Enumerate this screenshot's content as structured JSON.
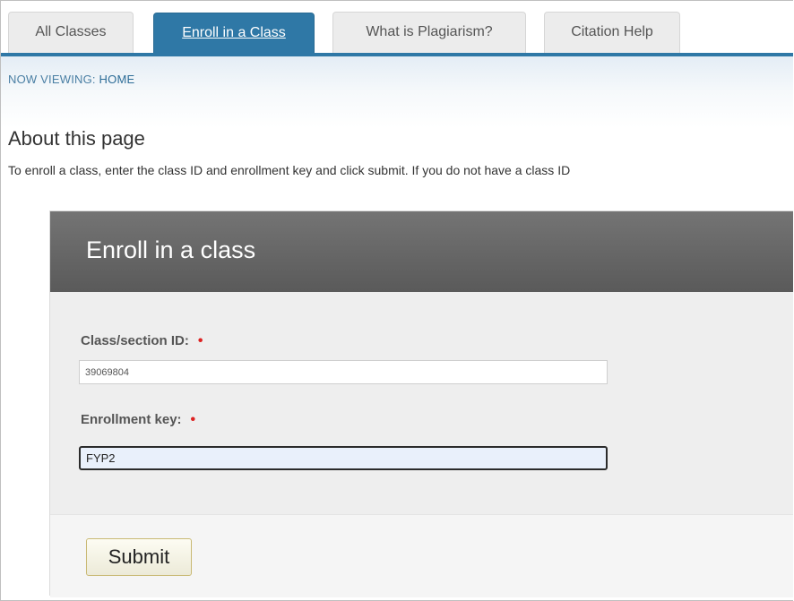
{
  "tabs": [
    {
      "label": "All Classes",
      "active": false
    },
    {
      "label": "Enroll in a Class",
      "active": true
    },
    {
      "label": "What is Plagiarism?",
      "active": false
    },
    {
      "label": "Citation Help",
      "active": false
    }
  ],
  "breadcrumb": {
    "prefix": "NOW VIEWING: ",
    "current": "HOME"
  },
  "about": {
    "title": "About this page",
    "text": "To enroll a class, enter the class ID and enrollment key and click submit. If you do not have a class ID"
  },
  "form": {
    "title": "Enroll in a class",
    "class_id": {
      "label": "Class/section ID:",
      "required_mark": "•",
      "value": "39069804"
    },
    "enrollment_key": {
      "label": "Enrollment key:",
      "required_mark": "•",
      "value": "FYP2"
    },
    "submit_label": "Submit"
  },
  "colors": {
    "accent": "#2f78a6",
    "header_gray": "#5a5a5a",
    "required": "#dd2222"
  }
}
